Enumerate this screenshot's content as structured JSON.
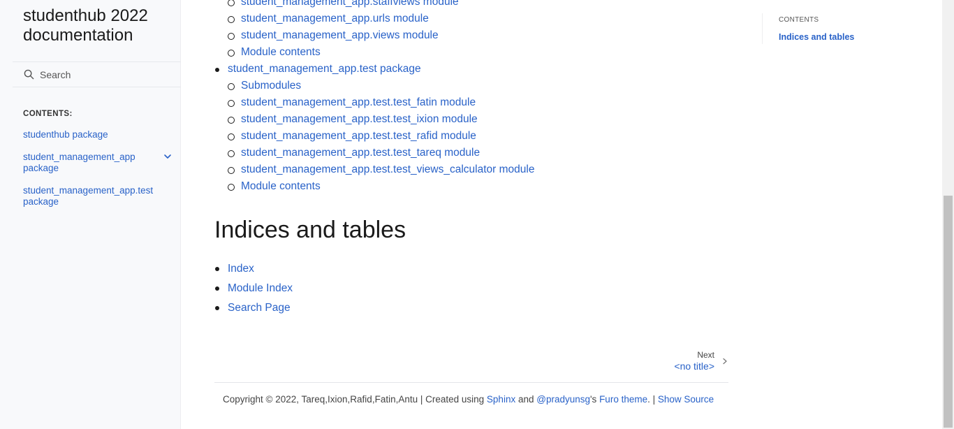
{
  "sidebar": {
    "brand": "studenthub 2022 documentation",
    "search_placeholder": "Search",
    "caption": "CONTENTS:",
    "items": [
      {
        "label": "studenthub package"
      },
      {
        "label": "student_management_app package"
      },
      {
        "label": "student_management_app.test package"
      }
    ]
  },
  "main": {
    "toc_top": [
      "student_management_app.staffviews module",
      "student_management_app.urls module",
      "student_management_app.views module",
      "Module contents"
    ],
    "test_package": {
      "label": "student_management_app.test package",
      "children": [
        "Submodules",
        "student_management_app.test.test_fatin module",
        "student_management_app.test.test_ixion module",
        "student_management_app.test.test_rafid module",
        "student_management_app.test.test_tareq module",
        "student_management_app.test.test_views_calculator module",
        "Module contents"
      ]
    },
    "heading": "Indices and tables",
    "links": [
      "Index",
      "Module Index",
      "Search Page"
    ],
    "next": {
      "label": "Next",
      "title": "<no title>"
    },
    "footer": {
      "copyright": "Copyright © 2022, Tareq,Ixion,Rafid,Fatin,Antu | Created using ",
      "sphinx": "Sphinx",
      "and": " and ",
      "pradyunsg": "@pradyunsg",
      "apostrophe": "'s ",
      "furo": "Furo theme",
      "sep": ". | ",
      "show_source": "Show Source"
    }
  },
  "right_toc": {
    "caption": "CONTENTS",
    "item": "Indices and tables"
  },
  "colors": {
    "link": "#2962c8",
    "sidebar_bg": "#f8f9fb"
  }
}
